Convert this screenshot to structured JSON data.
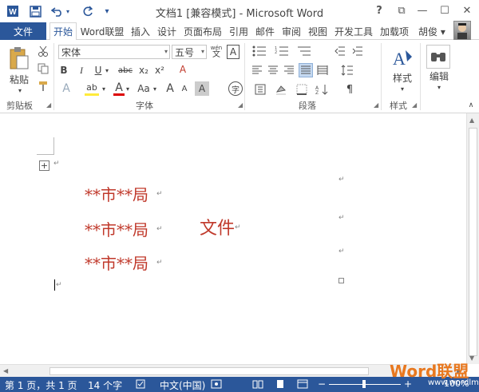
{
  "window": {
    "title": "文档1 [兼容模式] - Microsoft Word",
    "qat": {
      "save_icon": "save-icon",
      "undo_icon": "undo-icon",
      "redo_icon": "redo-icon",
      "customize_icon": "chevron-down-icon"
    },
    "buttons": {
      "help": "?",
      "restore": "⧉",
      "minimize": "—",
      "maximize": "☐",
      "close": "✕"
    }
  },
  "tabs": {
    "file": "文件",
    "items": [
      "开始",
      "Word联盟",
      "插入",
      "设计",
      "页面布局",
      "引用",
      "邮件",
      "审阅",
      "视图",
      "开发工具",
      "加载项"
    ],
    "active_index": 0,
    "user": "胡俊 ▾"
  },
  "ribbon": {
    "clipboard": {
      "label": "剪贴板",
      "paste": "粘贴"
    },
    "font": {
      "label": "字体",
      "font_name": "宋体",
      "font_size": "五号",
      "phonetic_top": "wén",
      "phonetic_bottom": "文",
      "border_char": "A",
      "bold": "B",
      "italic": "I",
      "underline": "U",
      "strike": "abc",
      "subscript": "x₂",
      "superscript": "x²",
      "clear": "A",
      "effect": "A",
      "highlight": "ab",
      "font_color": "A",
      "change_case": "Aa",
      "grow": "A",
      "shrink": "A",
      "char_shade": "A",
      "enclose": "字"
    },
    "paragraph": {
      "label": "段落"
    },
    "styles": {
      "label": "样式",
      "button": "样式"
    },
    "editing": {
      "button": "编辑"
    }
  },
  "document": {
    "line1": "**市**局",
    "line2a": "**市**局",
    "line2b": "文件",
    "line3": "**市**局",
    "para_mark": "↵"
  },
  "statusbar": {
    "page": "第 1 页，共 1 页",
    "words": "14 个字",
    "language": "中文(中国)",
    "zoom": "100%"
  },
  "watermark": {
    "brand": "Word联盟",
    "url": "www.wordlm.com"
  },
  "colors": {
    "accent": "#2b579a",
    "doc_text": "#c0392b",
    "watermark": "#e8781f"
  }
}
